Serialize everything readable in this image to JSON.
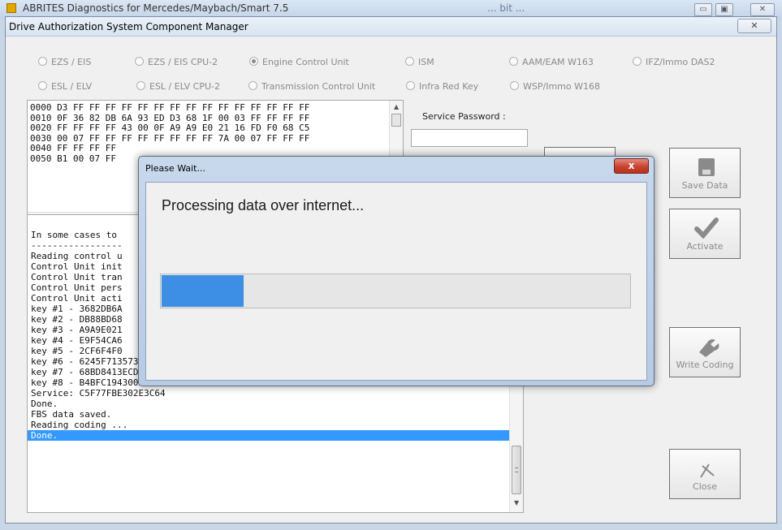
{
  "background_window": {
    "title": "ABRITES Diagnostics for Mercedes/Maybach/Smart 7.5",
    "right_text": "... bit ..."
  },
  "dialog": {
    "title": "Drive Authorization System Component Manager",
    "close_glyph": "✕",
    "radios_row1": [
      {
        "label": "EZS / EIS",
        "selected": false
      },
      {
        "label": "EZS / EIS CPU-2",
        "selected": false
      },
      {
        "label": "Engine Control Unit",
        "selected": true
      },
      {
        "label": "ISM",
        "selected": false
      },
      {
        "label": "AAM/EAM W163",
        "selected": false
      },
      {
        "label": "IFZ/Immo DAS2",
        "selected": false
      }
    ],
    "radios_row2": [
      {
        "label": "ESL / ELV",
        "selected": false
      },
      {
        "label": "ESL / ELV CPU-2",
        "selected": false
      },
      {
        "label": "Transmission Control Unit",
        "selected": false
      },
      {
        "label": "Infra Red Key",
        "selected": false
      },
      {
        "label": "WSP/Immo W168",
        "selected": false
      }
    ],
    "hex_lines": [
      "0000 D3 FF FF FF FF FF FF FF FF FF FF FF FF FF FF FF",
      "0010 0F 36 82 DB 6A 93 ED D3 68 1F 00 03 FF FF FF FF",
      "0020 FF FF FF FF 43 00 0F A9 A9 E0 21 16 FD F0 68 C5",
      "0030 00 07 FF FF FF FF FF FF FF FF 7A 00 07 FF FF FF",
      "0040 FF FF FF FF",
      "0050 B1 00 07 FF"
    ],
    "service_password_label": "Service Password :",
    "service_password_value": "",
    "log_lines": [
      "In some cases to",
      "-----------------",
      "Reading control u",
      "Control Unit init",
      "Control Unit tran",
      "Control Unit pers",
      "Control Unit acti",
      "key #1 - 3682DB6A",
      "key #2 - DB88BD68",
      "key #3 - A9A9E021",
      "key #4 - E9F54CA6",
      "key #5 - 2CF6F4F0",
      "key #6 - 6245F71357361A23",
      "key #7 - 68BD8413ECD61784",
      "key #8 - B4BFC194300EA39B",
      "Service: C5F77FBE302E3C64",
      "Done.",
      "FBS data saved.",
      "Reading coding ...",
      "Done."
    ],
    "buttons": {
      "save_data": "Save Data",
      "activate": "Activate",
      "write_coding": "Write Coding",
      "close": "Close"
    }
  },
  "wait_popup": {
    "title": "Please Wait...",
    "close_glyph": "x",
    "message": "Processing data over internet...",
    "progress": 0.175
  }
}
